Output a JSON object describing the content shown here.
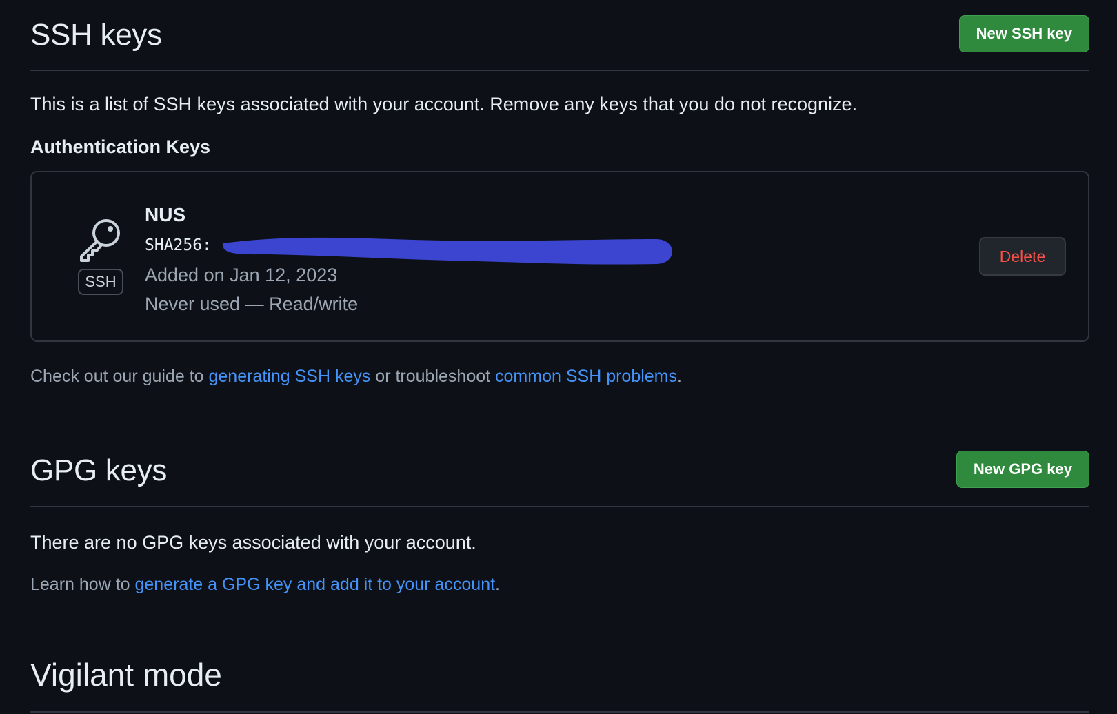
{
  "ssh": {
    "title": "SSH keys",
    "new_button": "New SSH key",
    "description": "This is a list of SSH keys associated with your account. Remove any keys that you do not recognize.",
    "subheading": "Authentication Keys",
    "key": {
      "badge": "SSH",
      "name": "NUS",
      "fingerprint_prefix": "SHA256:",
      "added": "Added on Jan 12, 2023",
      "usage": "Never used — Read/write",
      "delete_button": "Delete"
    },
    "guide": {
      "prefix": "Check out our guide to ",
      "link1": "generating SSH keys",
      "middle": " or troubleshoot ",
      "link2": "common SSH problems",
      "suffix": "."
    }
  },
  "gpg": {
    "title": "GPG keys",
    "new_button": "New GPG key",
    "empty_text": "There are no GPG keys associated with your account.",
    "learn": {
      "prefix": "Learn how to ",
      "link": "generate a GPG key and add it to your account",
      "suffix": "."
    }
  },
  "vigilant": {
    "title": "Vigilant mode"
  },
  "colors": {
    "background": "#0d1117",
    "green_button": "#2f8a3e",
    "link": "#4493f8",
    "danger": "#f85149",
    "redaction": "#3c45cf"
  }
}
